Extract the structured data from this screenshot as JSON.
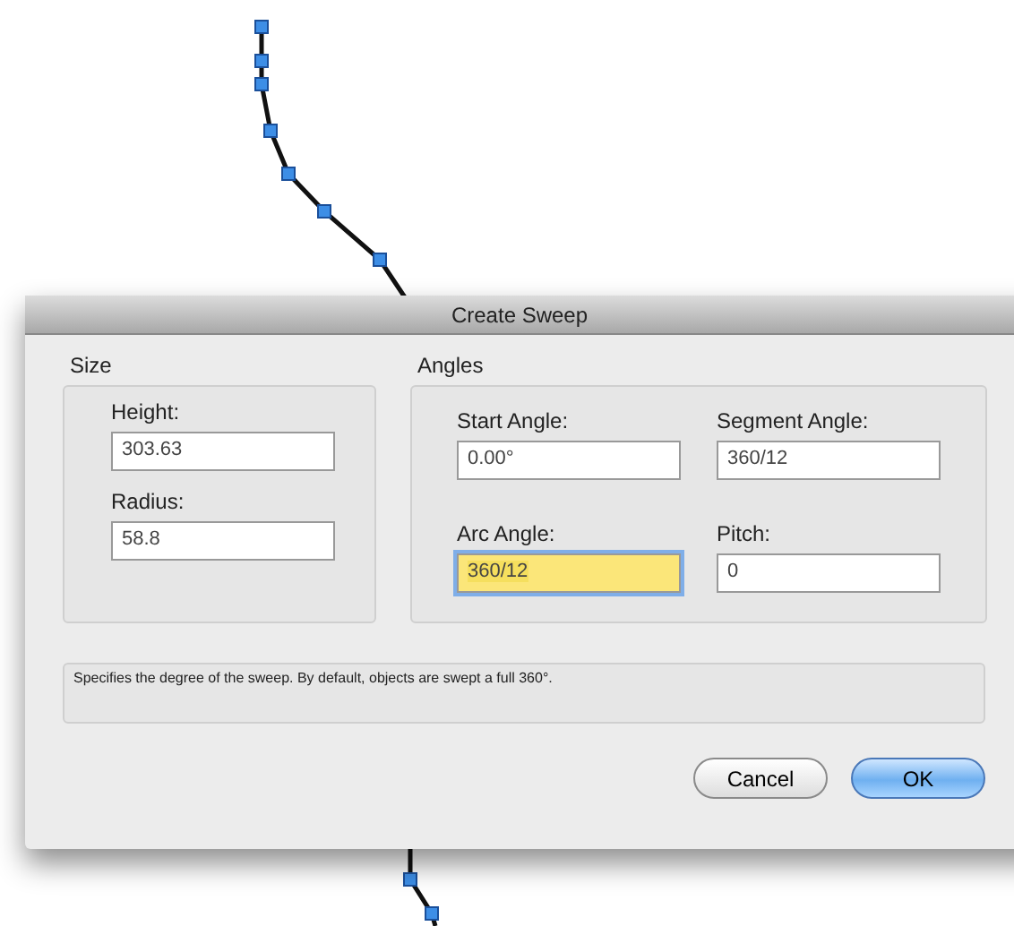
{
  "dialog": {
    "title": "Create Sweep",
    "size": {
      "title": "Size",
      "fields": [
        {
          "label": "Height:",
          "value": "303.63",
          "focused": false
        },
        {
          "label": "Radius:",
          "value": "58.8",
          "focused": false
        }
      ]
    },
    "angles": {
      "title": "Angles",
      "fields": [
        {
          "label": "Start Angle:",
          "value": "0.00°",
          "focused": false
        },
        {
          "label": "Segment Angle:",
          "value": "360/12",
          "focused": false
        },
        {
          "label": "Arc Angle:",
          "value": "360/12",
          "focused": true
        },
        {
          "label": "Pitch:",
          "value": "0",
          "focused": false
        }
      ]
    },
    "description": "Specifies the degree of the sweep. By default, objects are swept a full 360°.",
    "buttons": [
      {
        "label": "Cancel",
        "default": false
      },
      {
        "label": "OK",
        "default": true
      }
    ]
  }
}
